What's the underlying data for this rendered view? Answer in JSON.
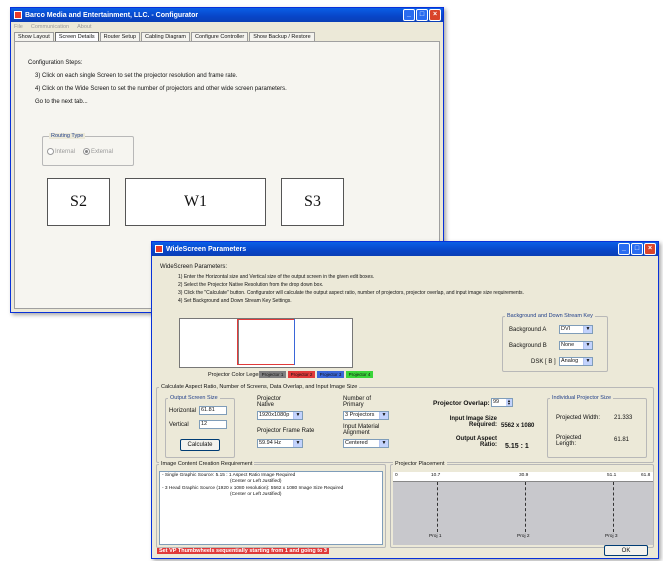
{
  "config_window": {
    "title": "Barco Media and Entertainment, LLC. - Configurator",
    "menu": [
      "File",
      "Communication",
      "About"
    ],
    "tabs": [
      "Show Layout",
      "Screen Details",
      "Router Setup",
      "Cabling Diagram",
      "Configure Controller",
      "Show Backup / Restore"
    ],
    "steps_title": "Configuration Steps:",
    "steps": [
      "3) Click on each single Screen to set the projector resolution and frame rate.",
      "4) Click on the Wide Screen to set the number of projectors and other wide screen parameters.",
      "Go to the next tab..."
    ],
    "routing_type": {
      "label": "Routing Type",
      "options": [
        "Internal",
        "External"
      ],
      "selected": "External"
    },
    "screens": [
      "S2",
      "W1",
      "S3"
    ]
  },
  "ws_window": {
    "title": "WideScreen Parameters",
    "section_title": "WideScreen Parameters:",
    "instructions": [
      "1) Enter the Horizontal size and Vertical size of the output screen in the given edit boxes.",
      "2) Select the Projector Native Resolution from the drop down box.",
      "3) Click the \"Calculate\" button. Configurator will calculate the output aspect ratio, number of projectors, projector overlap, and input image size requirements.",
      "4) Set Background and Down Stream Key Settings."
    ],
    "projector_legend_label": "Projector Color Legend:",
    "projector_legend": [
      {
        "label": "Projector 1",
        "color": "#7f7f7f"
      },
      {
        "label": "Projector 2",
        "color": "#e03a3a"
      },
      {
        "label": "Projector 3",
        "color": "#3a66d8"
      },
      {
        "label": "Projector 4",
        "color": "#3ad43a"
      }
    ],
    "bg_key": {
      "title": "Background and Down Stream Key",
      "bg_a_label": "Background A",
      "bg_a_value": "DVI",
      "bg_b_label": "Background B",
      "bg_b_value": "None",
      "dsk_label": "DSK [ B ]",
      "dsk_value": "Analog"
    },
    "calc_section": {
      "title": "Calculate Aspect Ratio, Number of Screens, Data Overlap, and Input Image Size",
      "output_screen_size": "Output Screen Size",
      "horizontal_label": "Horizontal",
      "horizontal_value": "61.81",
      "vertical_label": "Vertical",
      "vertical_value": "12",
      "calculate_button": "Calculate",
      "projector_native_label": "Projector Native",
      "projector_native_value": "1920x1080p",
      "frame_rate_label": "Projector Frame Rate",
      "frame_rate_value": "59.94 Hz",
      "number_primary_label": "Number of Primary",
      "number_primary_value": "3 Projectors",
      "alignment_label": "Input Material Alignment",
      "alignment_value": "Centered",
      "overlap_label": "Projector Overlap:",
      "overlap_value": "99",
      "input_size_label": "Input Image Size Required:",
      "input_size_value": "5562 x 1080",
      "aspect_label": "Output Aspect Ratio:",
      "aspect_value": "5.15 : 1"
    },
    "individual": {
      "title": "Individual Projector Size",
      "width_label": "Projected Width:",
      "width_value": "21.333",
      "length_label": "Projected Length:",
      "length_value": "61.81"
    },
    "image_content": {
      "title": "Image Content Creation Requirement",
      "lines": [
        "- Single Graphic Source:   5.15 : 1 Aspect Ratio Image Required",
        "(Center or Left Justified)",
        "- 3 Head Graphic Source (1920 x 1080 resolution): 5562 x 1080 Image Size Required",
        "(Center or Left Justified)"
      ]
    },
    "placement": {
      "title": "Projector Placement",
      "ticks": [
        "0",
        "10.7",
        "30.9",
        "51.1",
        "61.8"
      ],
      "projectors": [
        "Proj 1",
        "Proj 2",
        "Proj 3"
      ]
    },
    "warning": "Set VP Thumbwheels sequentially starting from 1 and going to 3",
    "ok_button": "OK"
  }
}
